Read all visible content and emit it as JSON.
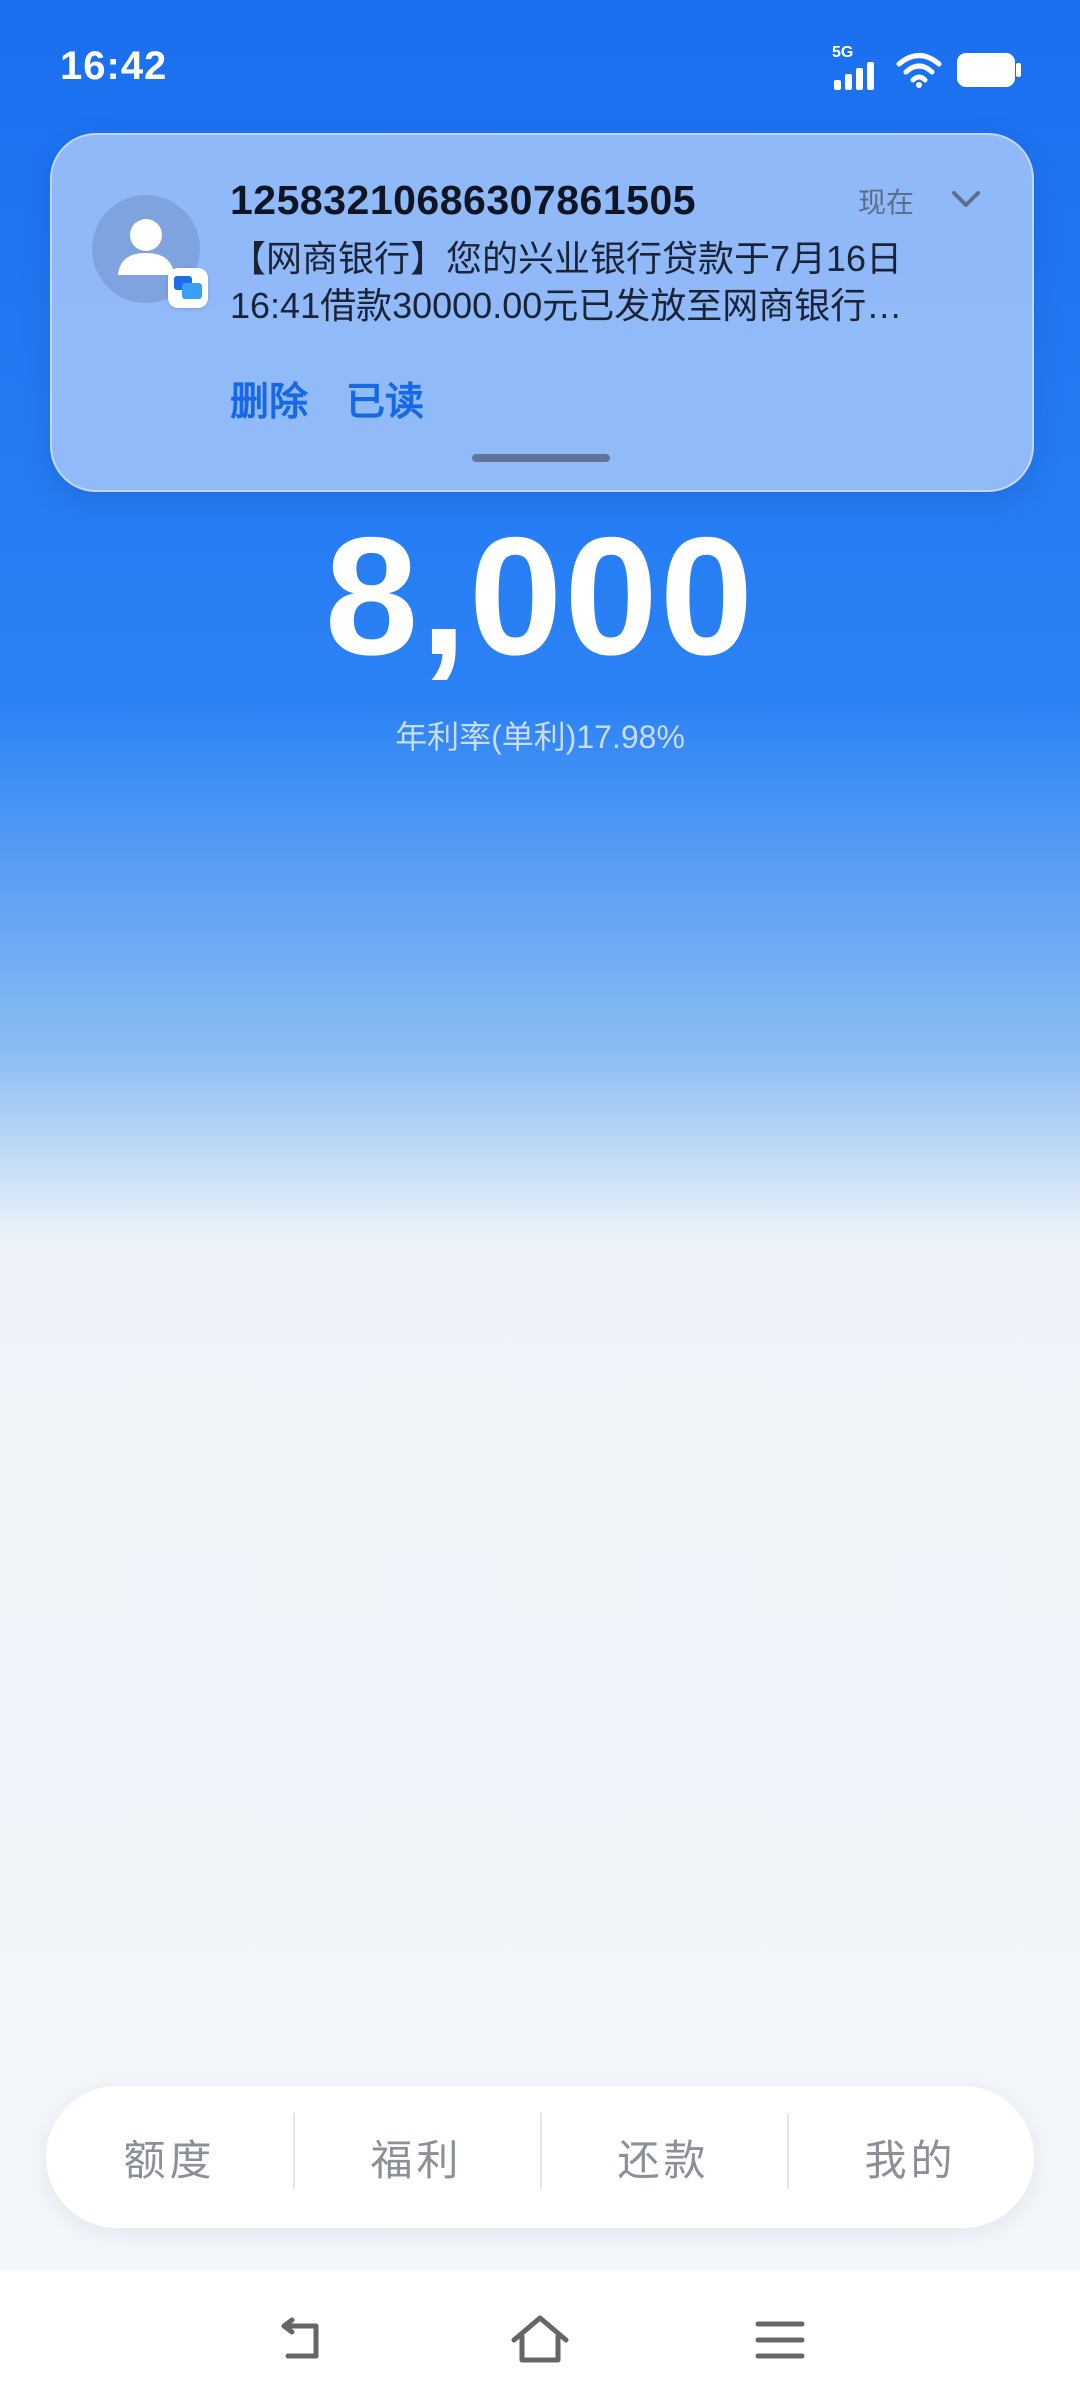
{
  "status_bar": {
    "time": "16:42",
    "network_label": "5G",
    "icons": [
      "signal-icon",
      "wifi-icon",
      "battery-icon"
    ]
  },
  "notification": {
    "sender": "1258321068630786150​5",
    "sender_display": "12583210686307861505",
    "time": "现在",
    "message": "【网商银行】您的兴业银行贷款于7月16日16:41借款30000.00元已发放至网商银行…",
    "actions": {
      "delete": "删除",
      "read": "已读"
    },
    "icons": [
      "avatar-icon",
      "messages-app-icon",
      "chevron-down-icon"
    ]
  },
  "loan": {
    "amount": "8,000",
    "rate_label": "年利率(单利)17.98%"
  },
  "tabs": [
    {
      "label": "额度"
    },
    {
      "label": "福利"
    },
    {
      "label": "还款"
    },
    {
      "label": "我的"
    }
  ],
  "system_nav": [
    "back-icon",
    "home-icon",
    "menu-icon"
  ],
  "colors": {
    "primary_blue": "#1a6ff0",
    "action_blue": "#1668e6",
    "tab_text": "#8a8f98"
  }
}
